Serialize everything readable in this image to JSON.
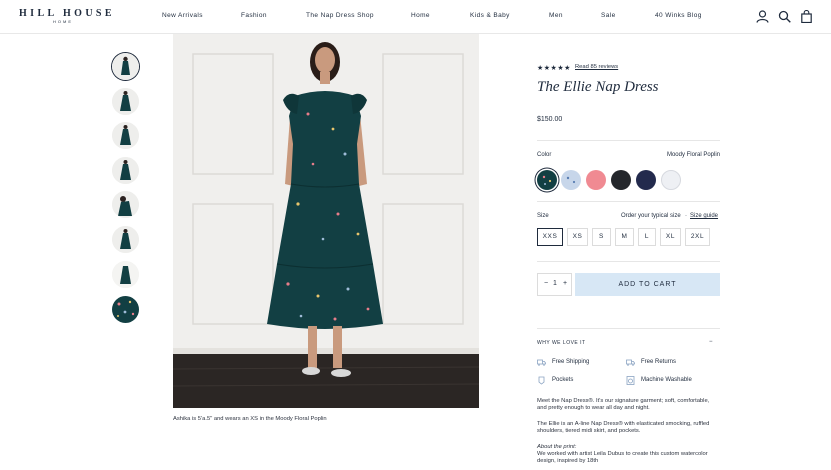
{
  "header": {
    "logo_line1": "HILL HOUSE",
    "logo_line2": "HOME",
    "nav": [
      "New Arrivals",
      "Fashion",
      "The Nap Dress Shop",
      "Home",
      "Kids & Baby",
      "Men",
      "Sale",
      "40 Winks Blog"
    ],
    "icons": [
      "account-icon",
      "search-icon",
      "bag-icon"
    ]
  },
  "gallery": {
    "thumbnail_count": 8,
    "selected_index": 0,
    "caption": "Ashika is 5'a.5\" and wears an XS in the Moody Floral Poplin"
  },
  "product": {
    "rating": 5,
    "stars": "★★★★★",
    "reviews_link": "Read 85 reviews",
    "title": "The Ellie Nap Dress",
    "price": "$150.00",
    "color_label": "Color",
    "color_value": "Moody Floral Poplin",
    "swatches": [
      {
        "name": "moody-floral",
        "color": "#123f43",
        "selected": true
      },
      {
        "name": "light-blue-floral",
        "color": "#c7d6ea"
      },
      {
        "name": "pink",
        "color": "#f08a92"
      },
      {
        "name": "black",
        "color": "#24272c"
      },
      {
        "name": "navy",
        "color": "#232a4d"
      },
      {
        "name": "white",
        "color": "#eef0f4"
      }
    ],
    "size_label": "Size",
    "size_note": "Order your typical size",
    "size_guide": "Size guide",
    "sizes": [
      "XXS",
      "XS",
      "S",
      "M",
      "L",
      "XL",
      "2XL"
    ],
    "selected_size": "XXS",
    "quantity": "1",
    "qty_minus": "−",
    "qty_plus": "+",
    "add_to_cart": "ADD TO CART",
    "why_label": "WHY WE LOVE IT",
    "why_toggle": "−",
    "features": {
      "shipping": "Free Shipping",
      "returns": "Free Returns",
      "pockets": "Pockets",
      "washable": "Machine Washable"
    },
    "desc_1": "Meet the Nap Dress®.  It's our signature garment; soft, comfortable, and pretty enough to wear all day and night.",
    "desc_2": "The Ellie is an A-line Nap Dress® with elasticated smocking, ruffled shoulders, tiered midi skirt, and pockets.",
    "desc_3_title": "About the print:",
    "desc_3": "We worked with artist Leila Dubus to create this custom watercolor design, inspired by 18th"
  },
  "colors": {
    "text": "#1f2b3d",
    "cart_button": "#d7e7f5",
    "dress": "#123f43"
  }
}
